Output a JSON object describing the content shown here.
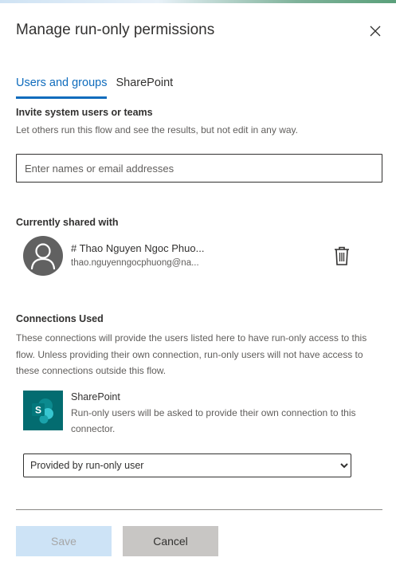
{
  "panel": {
    "title": "Manage run-only permissions",
    "close_icon": "close-icon"
  },
  "tabs": [
    {
      "label": "Users and groups",
      "active": true
    },
    {
      "label": "SharePoint",
      "active": false
    }
  ],
  "invite": {
    "heading": "Invite system users or teams",
    "description": "Let others run this flow and see the results, but not edit in any way.",
    "placeholder": "Enter names or email addresses",
    "value": ""
  },
  "shared": {
    "heading": "Currently shared with",
    "users": [
      {
        "name": "# Thao Nguyen Ngoc Phuo...",
        "email": "thao.nguyenngocphuong@na...",
        "avatar_icon": "person-icon",
        "delete_icon": "trash-icon"
      }
    ]
  },
  "connections": {
    "heading": "Connections Used",
    "description": "These connections will provide the users listed here to have run-only access to this flow. Unless providing their own connection, run-only users will not have access to these connections outside this flow.",
    "items": [
      {
        "name": "SharePoint",
        "description": "Run-only users will be asked to provide their own connection to this connector.",
        "icon": "sharepoint-logo-icon",
        "selected_option": "Provided by run-only user"
      }
    ]
  },
  "footer": {
    "save_label": "Save",
    "cancel_label": "Cancel"
  },
  "colors": {
    "accent": "#0f6cbd",
    "sharepoint": "#036c70",
    "save_disabled_bg": "#cde3f6",
    "cancel_bg": "#c8c6c4"
  }
}
